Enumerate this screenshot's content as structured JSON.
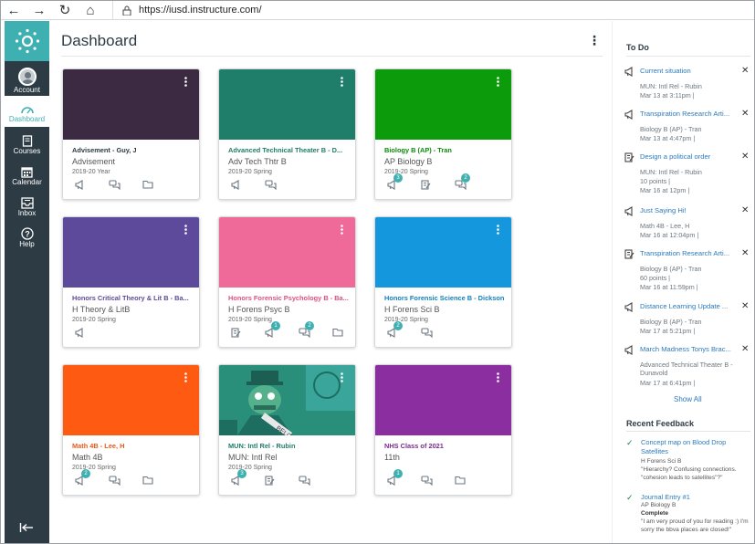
{
  "browser": {
    "back": "←",
    "forward": "→",
    "reload": "↻",
    "home": "⌂",
    "lock": "🔒",
    "url": "https://iusd.instructure.com/"
  },
  "global_nav": {
    "logo_icon": "canvas-logo",
    "items": [
      {
        "label": "Account",
        "icon": "avatar",
        "active": false
      },
      {
        "label": "Dashboard",
        "icon": "dashboard-icon",
        "active": true
      },
      {
        "label": "Courses",
        "icon": "book-icon",
        "active": false
      },
      {
        "label": "Calendar",
        "icon": "calendar-icon",
        "active": false
      },
      {
        "label": "Inbox",
        "icon": "inbox-icon",
        "active": false
      },
      {
        "label": "Help",
        "icon": "help-icon",
        "active": false
      }
    ],
    "collapse_glyph": "|←"
  },
  "dashboard": {
    "title": "Dashboard",
    "menu": "⋮",
    "cards": [
      {
        "name": "Advisement - Guy, J",
        "code": "Advisement",
        "term": "2019-20 Year",
        "color": "#3b2a41",
        "name_color": "#2d3b45",
        "icons": [
          "announcement",
          "discussion",
          "files"
        ],
        "badges": []
      },
      {
        "name": "Advanced Technical Theater B - D...",
        "code": "Adv Tech Thtr B",
        "term": "2019-20 Spring",
        "color": "#1f7e6a",
        "name_color": "#1f7e6a",
        "icons": [
          "announcement",
          "discussion"
        ],
        "badges": []
      },
      {
        "name": "Biology B (AP) - Tran",
        "code": "AP Biology B",
        "term": "2019-20 Spring",
        "color": "#0b9b0b",
        "name_color": "#0b8a0b",
        "icons": [
          "announcement",
          "assignment",
          "discussion"
        ],
        "badges": [
          {
            "pos": 0,
            "n": "3"
          },
          {
            "pos": 2,
            "n": "2"
          }
        ]
      },
      {
        "name": "Honors Critical Theory & Lit B - Ba...",
        "code": "H Theory & LitB",
        "term": "2019-20 Spring",
        "color": "#5e4a9b",
        "name_color": "#5e4a9b",
        "icons": [
          "announcement"
        ],
        "badges": []
      },
      {
        "name": "Honors Forensic Psychology B - Ba...",
        "code": "H Forens Psyc B",
        "term": "2019-20 Spring",
        "color": "#ef6a98",
        "name_color": "#e0507f",
        "icons": [
          "assignment",
          "announcement",
          "discussion",
          "files"
        ],
        "badges": [
          {
            "pos": 1,
            "n": "1"
          },
          {
            "pos": 2,
            "n": "2"
          }
        ]
      },
      {
        "name": "Honors Forensic Science B - Dickson",
        "code": "H Forens Sci B",
        "term": "2019-20 Spring",
        "color": "#1597dd",
        "name_color": "#1280c0",
        "icons": [
          "announcement",
          "discussion"
        ],
        "badges": [
          {
            "pos": 0,
            "n": "2"
          }
        ]
      },
      {
        "name": "Math 4B - Lee, H",
        "code": "Math 4B",
        "term": "2019-20 Spring",
        "color": "#ff5a12",
        "name_color": "#e85a1c",
        "icons": [
          "announcement",
          "discussion",
          "files"
        ],
        "badges": [
          {
            "pos": 0,
            "n": "2"
          }
        ]
      },
      {
        "name": "MUN: Intl Rel - Rubin",
        "code": "MUN: Intl Rel",
        "term": "2019-20 Spring",
        "color": "#2a8f7a",
        "name_color": "#1f7e6a",
        "icons": [
          "announcement",
          "assignment",
          "discussion"
        ],
        "badges": [
          {
            "pos": 0,
            "n": "3"
          }
        ]
      },
      {
        "name": "NHS Class of 2021",
        "code": "11th",
        "term": "",
        "color": "#8b2fa0",
        "name_color": "#7a2a8f",
        "icons": [
          "announcement",
          "discussion",
          "files"
        ],
        "badges": [
          {
            "pos": 0,
            "n": "1"
          }
        ]
      }
    ]
  },
  "todo": {
    "title": "To Do",
    "items": [
      {
        "icon": "announcement",
        "title": "Current situation",
        "line1": "MUN: Intl Rel - Rubin",
        "line2": "Mar 13 at 3:11pm   |"
      },
      {
        "icon": "announcement",
        "title": "Transpiration Research Arti...",
        "line1": "Biology B (AP) - Tran",
        "line2": "Mar 13 at 4:47pm   |"
      },
      {
        "icon": "assignment",
        "title": "Design a political order",
        "line1": "MUN: Intl Rel - Rubin",
        "line2": "10 points   |",
        "line3": "Mar 16 at 12pm   |"
      },
      {
        "icon": "announcement",
        "title": "Just Saying Hi!",
        "line1": "Math 4B - Lee, H",
        "line2": "Mar 16 at 12:04pm   |"
      },
      {
        "icon": "assignment",
        "title": "Transpiration Research Arti...",
        "line1": "Biology B (AP) - Tran",
        "line2": "60 points   |",
        "line3": "Mar 16 at 11:59pm   |"
      },
      {
        "icon": "announcement",
        "title": "Distance Learning Update ...",
        "line1": "Biology B (AP) - Tran",
        "line2": "Mar 17 at 5:21pm   |"
      },
      {
        "icon": "announcement",
        "title": "March Madness Tonys Brac...",
        "line1": "Advanced Technical Theater B - Dunavold",
        "line2": "Mar 17 at 6:41pm   |"
      }
    ],
    "dismiss": "✕",
    "show_all": "Show All"
  },
  "recent_feedback": {
    "title": "Recent Feedback",
    "items": [
      {
        "title": "Concept map on Blood Drop Satellites",
        "course": "H Forens Sci B",
        "bold": "",
        "quote": "\"Hierarchy? Confusing connections. \"cohesion leads to satellites\"?\""
      },
      {
        "title": "Journal Entry #1",
        "course": "AP Biology B",
        "bold": "Complete",
        "quote": "\"I am very proud of you for reading :) I'm sorry the bbva places are closed!\""
      }
    ],
    "check": "✓"
  }
}
